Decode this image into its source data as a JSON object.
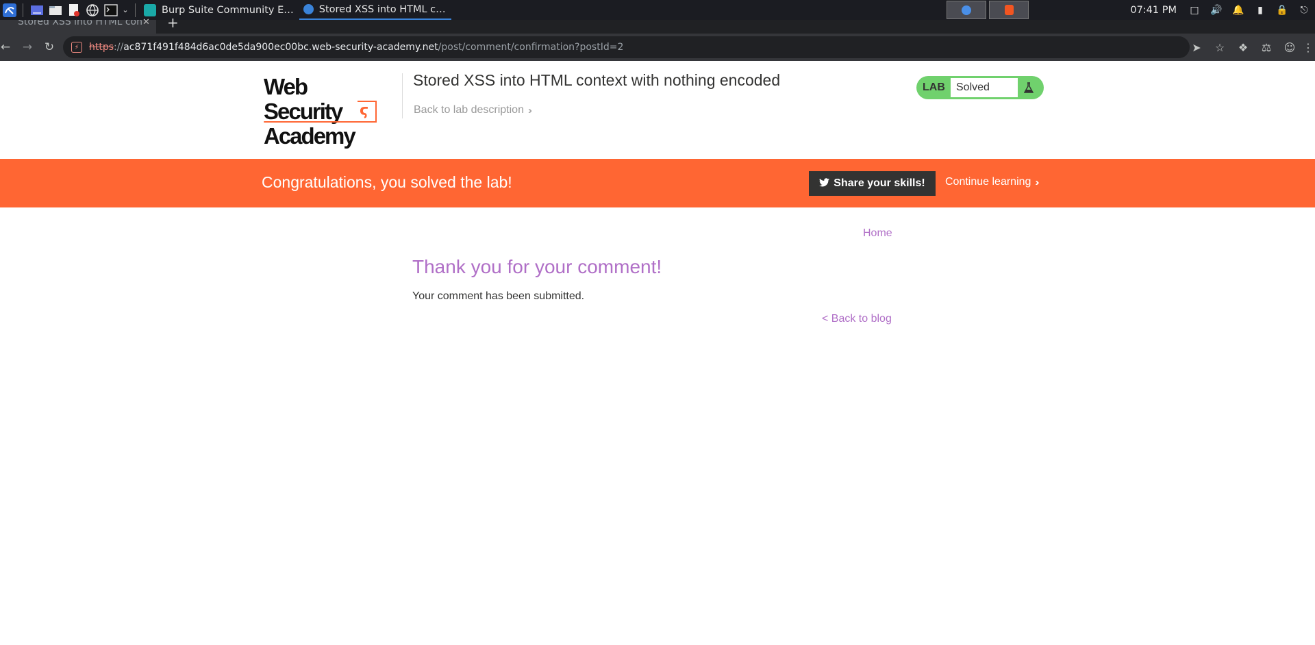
{
  "taskbar": {
    "tasks": [
      {
        "label": "Burp Suite Community E…",
        "icon": "burp-icon"
      },
      {
        "label": "Stored XSS into HTML c…",
        "icon": "chrome-icon"
      }
    ],
    "clock": "07:41 PM"
  },
  "browser": {
    "tab_title": "Stored XSS into HTML con",
    "url_scheme": "https",
    "url_separator": "://",
    "url_host": "ac871f491f484d6ac0de5da900ec00bc.web-security-academy.net",
    "url_path": "/post/comment/confirmation?postId=2"
  },
  "header": {
    "logo_line1": "Web Security",
    "logo_line2": "Academy",
    "lab_title": "Stored XSS into HTML context with nothing encoded",
    "back_to_description": "Back to lab description",
    "lab_badge_label": "LAB",
    "lab_status": "Solved"
  },
  "banner": {
    "message": "Congratulations, you solved the lab!",
    "share_label": "Share your skills!",
    "continue_label": "Continue learning"
  },
  "content": {
    "home_link": "Home",
    "heading": "Thank you for your comment!",
    "message": "Your comment has been submitted.",
    "back_link": "< Back to blog"
  },
  "colors": {
    "accent_orange": "#ff6633",
    "link_purple": "#b06fc7",
    "lab_green": "#70d16d"
  }
}
